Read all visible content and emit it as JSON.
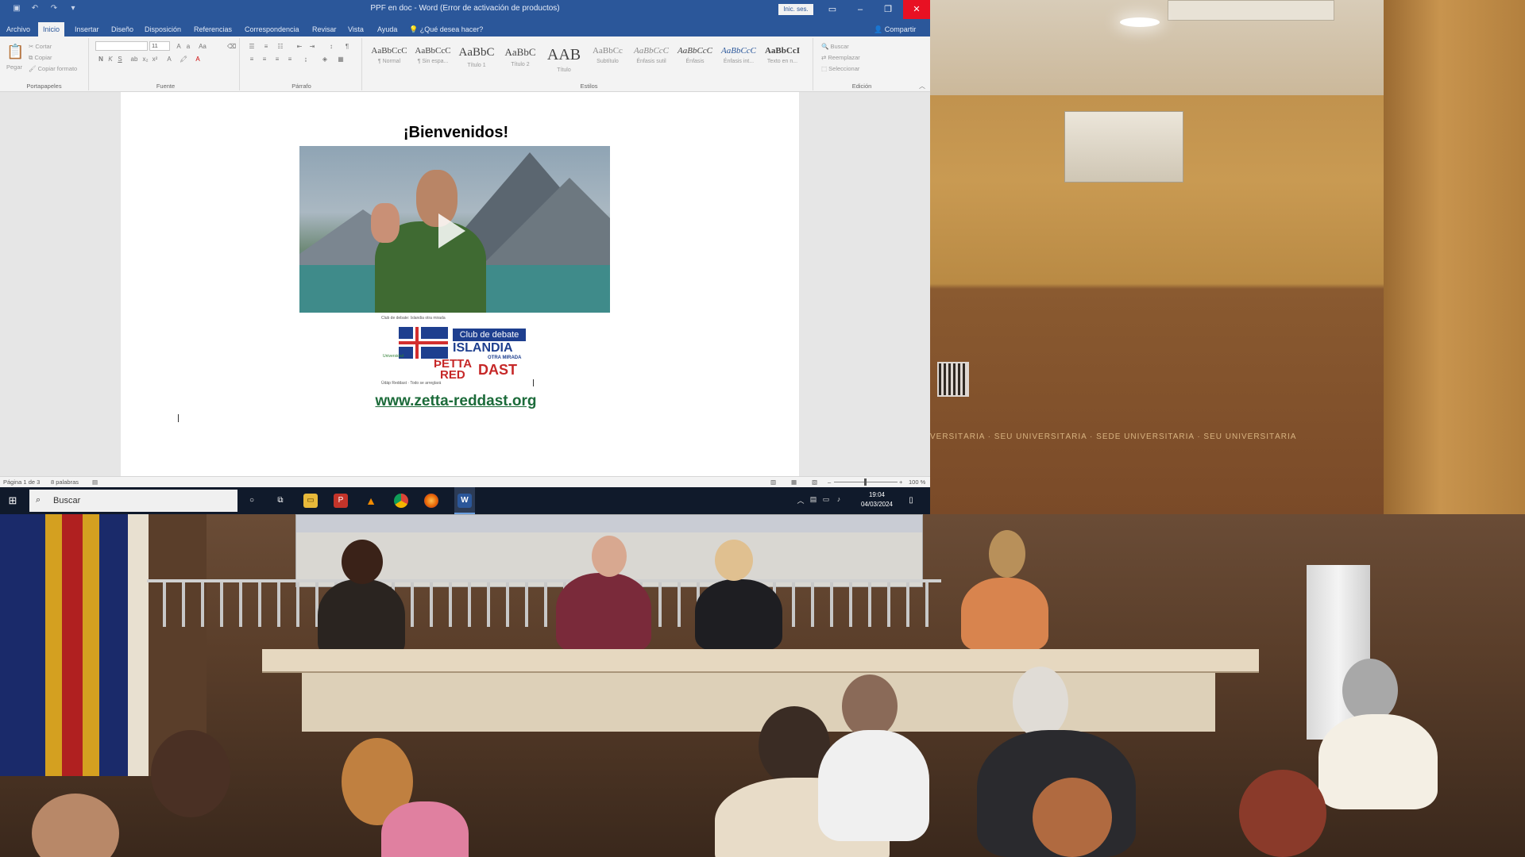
{
  "word": {
    "title": "PPF en doc - Word (Error de activación de productos)",
    "signin": "Inic. ses.",
    "tabs": [
      "Archivo",
      "Inicio",
      "Insertar",
      "Diseño",
      "Disposición",
      "Referencias",
      "Correspondencia",
      "Revisar",
      "Vista",
      "Ayuda"
    ],
    "active_tab": "Inicio",
    "tell_me": "¿Qué desea hacer?",
    "share": "Compartir",
    "ribbon": {
      "clipboard": {
        "label": "Portapapeles",
        "paste": "Pegar",
        "cut": "Cortar",
        "copy": "Copiar",
        "format_painter": "Copiar formato"
      },
      "font": {
        "label": "Fuente",
        "font_name": "",
        "font_size": "11"
      },
      "paragraph": {
        "label": "Párrafo"
      },
      "styles": {
        "label": "Estilos",
        "items": [
          {
            "sample": "AaBbCcC",
            "name": "¶ Normal"
          },
          {
            "sample": "AaBbCcC",
            "name": "¶ Sin espa..."
          },
          {
            "sample": "AaBbC",
            "name": "Título 1"
          },
          {
            "sample": "AaBbC",
            "name": "Título 2"
          },
          {
            "sample": "AAB",
            "name": "Título"
          },
          {
            "sample": "AaBbCc",
            "name": "Subtítulo"
          },
          {
            "sample": "AaBbCcC",
            "name": "Énfasis sutil"
          },
          {
            "sample": "AaBbCcC",
            "name": "Énfasis"
          },
          {
            "sample": "AaBbCcC",
            "name": "Énfasis int..."
          },
          {
            "sample": "AaBbCcI",
            "name": "Texto en n..."
          }
        ]
      },
      "editing": {
        "label": "Edición",
        "find": "Buscar",
        "replace": "Reemplazar",
        "select": "Seleccionar"
      }
    },
    "document": {
      "heading": "¡Bienvenidos!",
      "video_caption": "Club de debate: Islandia otra mirada",
      "logo": {
        "club": "Club de debate",
        "islandia": "ISLANDIA",
        "otra_mirada": "OTRA MIRADA",
        "petta": "ÞETTA",
        "red": "RED",
        "dast": "DAST",
        "small_left": "Universidad",
        "small_bottom": "Údáp Reddast · Todo se arreglará"
      },
      "link": "www.zetta-reddast.org"
    },
    "status": {
      "page": "Página 1 de 3",
      "words": "8 palabras",
      "zoom": "100 %"
    }
  },
  "taskbar": {
    "search_placeholder": "Buscar",
    "time": "19:04",
    "date": "04/03/2024",
    "apps": [
      "cortana-icon",
      "task-view-icon",
      "file-explorer-icon",
      "pdf-reader-icon",
      "vlc-icon",
      "chrome-icon",
      "firefox-icon",
      "word-icon"
    ]
  },
  "colors": {
    "word_blue": "#2b579a",
    "close_red": "#e81123",
    "taskbar": "#101a2b",
    "link_green": "#1c6b3a",
    "logo_blue": "#1e3f8f",
    "logo_red": "#c62828"
  },
  "room": {
    "wall_text": "VERSITÀRIA · SEU UNIVERSITÀRIA · SEDE UNIVERSITARIA · SEU UNIVERSITÀRIA"
  }
}
